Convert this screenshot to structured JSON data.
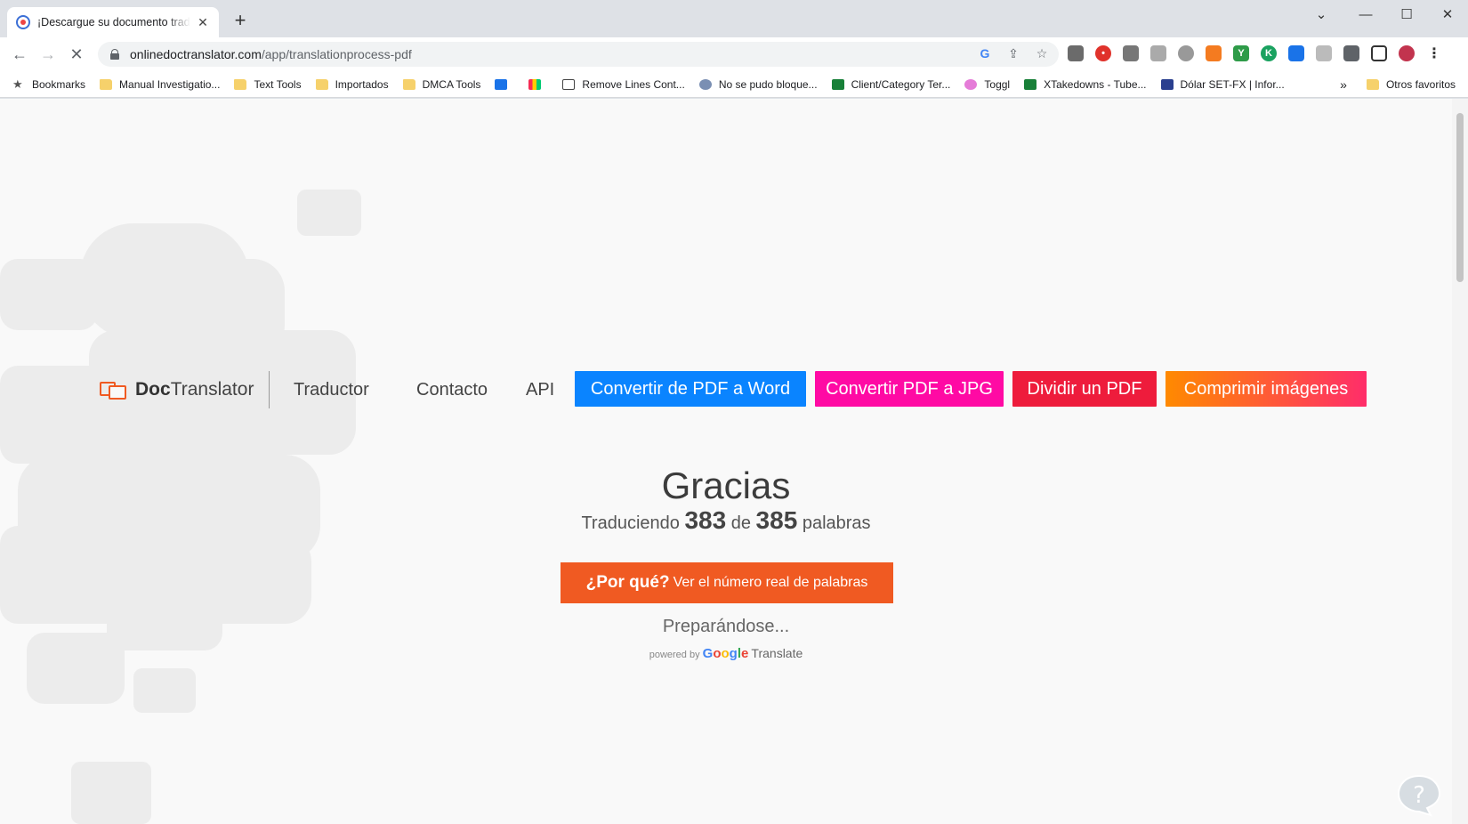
{
  "browser": {
    "tab_title": "¡Descargue su documento traducido",
    "url_host": "onlinedoctranslator.com",
    "url_path": "/app/translationprocess-pdf",
    "new_tab_symbol": "+",
    "tab_close_symbol": "✕"
  },
  "bookmarks_bar": {
    "items": [
      {
        "label": "Bookmarks",
        "icon": "star-icon"
      },
      {
        "label": "Manual Investigatio...",
        "icon": "folder-icon"
      },
      {
        "label": "Text Tools",
        "icon": "folder-icon"
      },
      {
        "label": "Importados",
        "icon": "folder-icon"
      },
      {
        "label": "DMCA Tools",
        "icon": "folder-icon"
      },
      {
        "label": "",
        "icon": "calendar-icon"
      },
      {
        "label": "",
        "icon": "monday-icon"
      },
      {
        "label": "Remove Lines Cont...",
        "icon": "text-tool-icon"
      },
      {
        "label": "No se pudo bloque...",
        "icon": "blocked-site-icon"
      },
      {
        "label": "Client/Category Ter...",
        "icon": "sheets-icon"
      },
      {
        "label": "Toggl",
        "icon": "toggl-icon"
      },
      {
        "label": "XTakedowns - Tube...",
        "icon": "sheets-icon"
      },
      {
        "label": "Dólar SET-FX | Infor...",
        "icon": "dollar-icon"
      }
    ],
    "overflow": "»",
    "other_favorites": "Otros favoritos"
  },
  "site_nav": {
    "brand_bold": "Doc",
    "brand_rest": "Translator",
    "links": [
      "Traductor",
      "Contacto",
      "API"
    ],
    "buttons": [
      {
        "label": "Convertir de PDF a Word",
        "color": "#0a84ff"
      },
      {
        "label": "Convertir PDF a JPG",
        "color": "#ff0aa4"
      },
      {
        "label": "Dividir un PDF",
        "color": "#ee1c3c"
      },
      {
        "label": "Comprimir imágenes",
        "color": "#ff6a2b"
      }
    ]
  },
  "status": {
    "title": "Gracias",
    "translating_prefix": "Traduciendo",
    "words_done": "383",
    "of_word": "de",
    "words_total": "385",
    "words_suffix": "palabras",
    "why_bold": "¿Por qué?",
    "why_text": "Ver el número real de palabras",
    "preparing": "Preparándose...",
    "powered_by": "powered by",
    "google": "Google",
    "translate": "Translate"
  },
  "colors": {
    "accent_orange": "#f05a22",
    "google_blue": "#4285f4",
    "google_red": "#ea4335",
    "google_yellow": "#fbbc05",
    "google_green": "#34a853"
  }
}
